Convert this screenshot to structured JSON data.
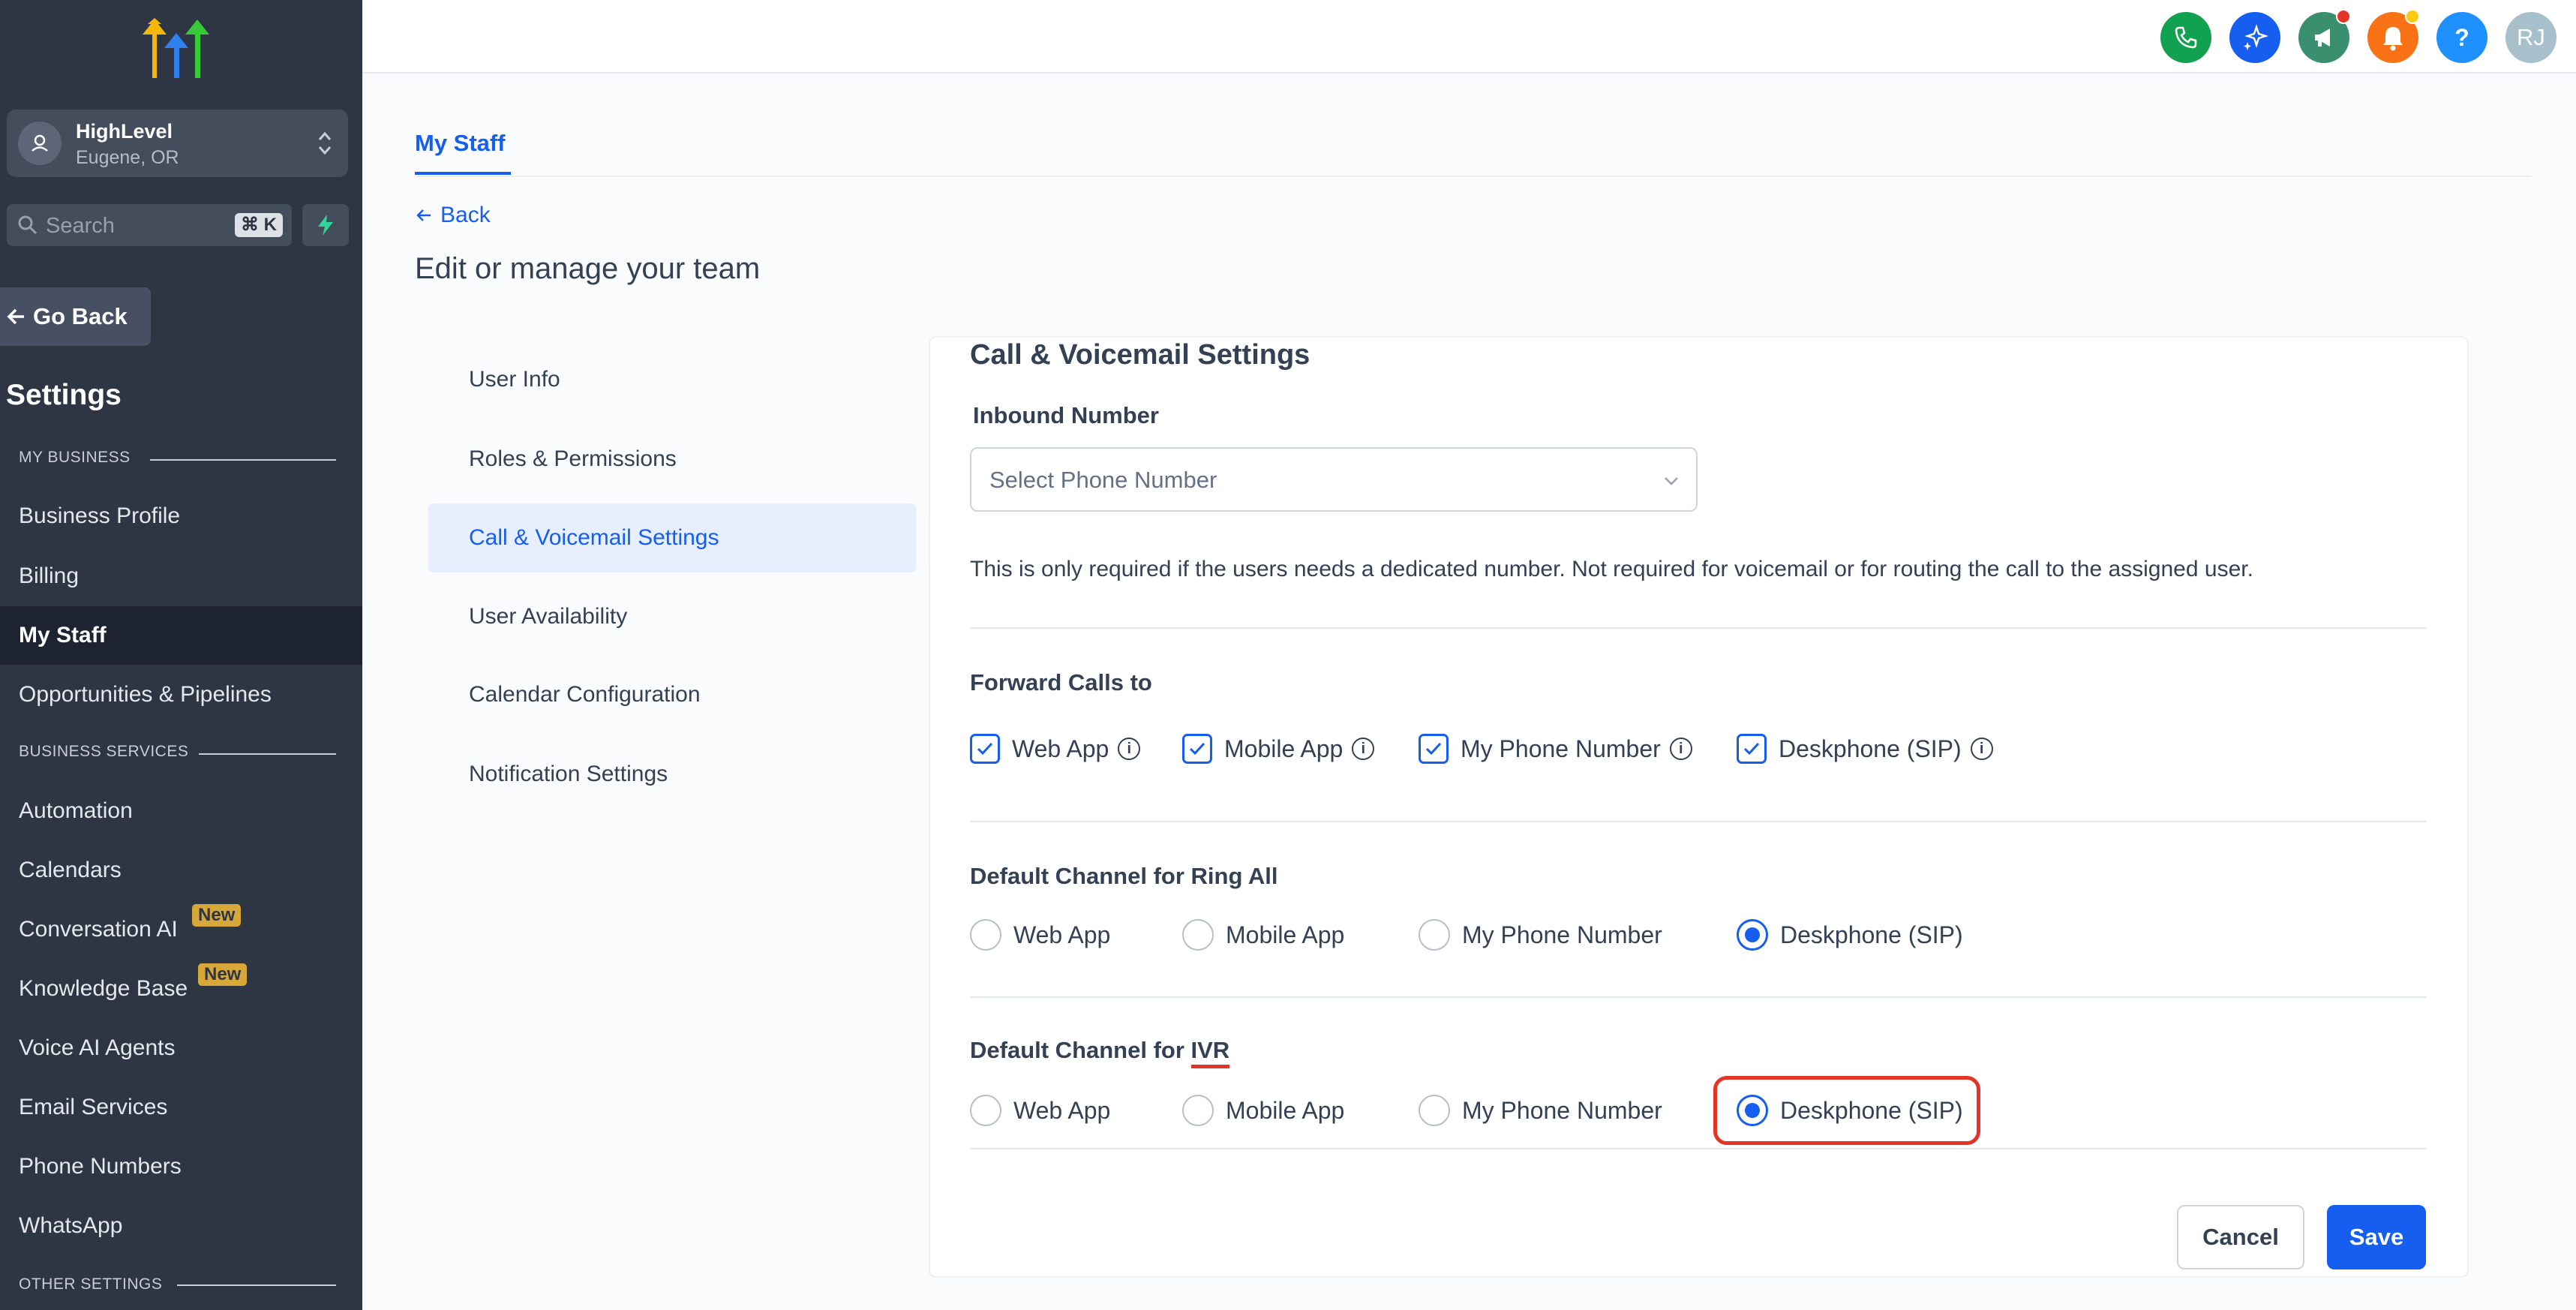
{
  "sidebar": {
    "account": {
      "name": "HighLevel",
      "location": "Eugene, OR"
    },
    "search": {
      "placeholder": "Search",
      "shortcut": "⌘ K"
    },
    "go_back": "Go Back",
    "title": "Settings",
    "sections": {
      "my_business": "MY BUSINESS",
      "business_services": "BUSINESS SERVICES",
      "other_settings": "OTHER SETTINGS"
    },
    "items": [
      {
        "label": "Business Profile"
      },
      {
        "label": "Billing"
      },
      {
        "label": "My Staff",
        "active": true
      },
      {
        "label": "Opportunities & Pipelines"
      },
      {
        "label": "Automation"
      },
      {
        "label": "Calendars"
      },
      {
        "label": "Conversation AI",
        "badge": "New"
      },
      {
        "label": "Knowledge Base",
        "badge": "New"
      },
      {
        "label": "Voice AI Agents"
      },
      {
        "label": "Email Services"
      },
      {
        "label": "Phone Numbers"
      },
      {
        "label": "WhatsApp"
      }
    ]
  },
  "topbar": {
    "icons": [
      {
        "name": "phone-icon",
        "color": "#12a150"
      },
      {
        "name": "sparkle-icon",
        "color": "#155eef"
      },
      {
        "name": "megaphone-icon",
        "color": "#3a8f6e"
      },
      {
        "name": "bell-icon",
        "color": "#f97316"
      },
      {
        "name": "help-icon",
        "color": "#1e90ff",
        "glyph": "?"
      }
    ],
    "avatar_initials": "RJ"
  },
  "main": {
    "tab": "My Staff",
    "back": "Back",
    "heading": "Edit or manage your team",
    "subnav": [
      {
        "label": "User Info"
      },
      {
        "label": "Roles & Permissions"
      },
      {
        "label": "Call & Voicemail Settings",
        "active": true
      },
      {
        "label": "User Availability"
      },
      {
        "label": "Calendar Configuration"
      },
      {
        "label": "Notification Settings"
      }
    ],
    "card": {
      "title": "Call & Voicemail Settings",
      "inbound_label": "Inbound Number",
      "inbound_placeholder": "Select Phone Number",
      "inbound_helper": "This is only required if the users needs a dedicated number. Not required for voicemail or for routing the call to the assigned user.",
      "forward_label": "Forward Calls to",
      "forward_options": [
        {
          "label": "Web App",
          "checked": true
        },
        {
          "label": "Mobile App",
          "checked": true
        },
        {
          "label": "My Phone Number",
          "checked": true
        },
        {
          "label": "Deskphone (SIP)",
          "checked": true
        }
      ],
      "ring_all_label": "Default Channel for Ring All",
      "ring_all_options": [
        "Web App",
        "Mobile App",
        "My Phone Number",
        "Deskphone (SIP)"
      ],
      "ring_all_selected": "Deskphone (SIP)",
      "ivr_label_prefix": "Default Channel for ",
      "ivr_label_term": "IVR",
      "ivr_options": [
        "Web App",
        "Mobile App",
        "My Phone Number",
        "Deskphone (SIP)"
      ],
      "ivr_selected": "Deskphone (SIP)",
      "cancel": "Cancel",
      "save": "Save"
    }
  },
  "colors": {
    "sidebar_bg": "#2e3644",
    "accent": "#155eef",
    "highlight": "#e23526",
    "badge": "#d8a73a"
  }
}
